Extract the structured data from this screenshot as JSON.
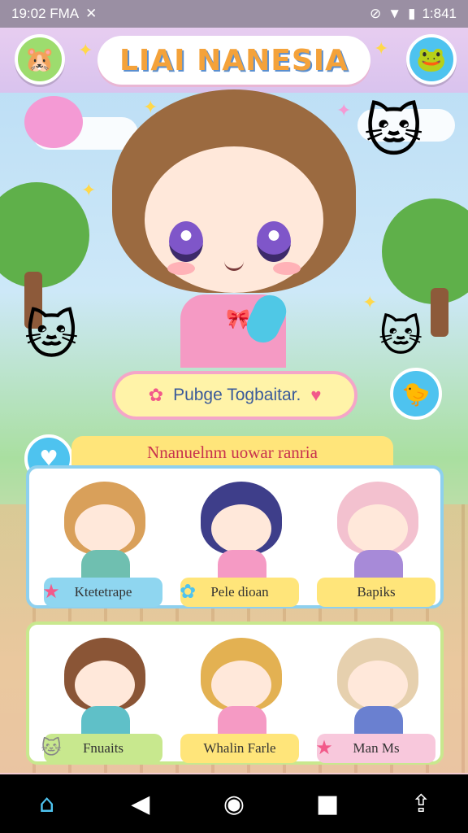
{
  "status_bar": {
    "time": "19:02 FMA",
    "clock": "1:841",
    "left_icon": "debug-icon",
    "right_icons": [
      "no-sim-icon",
      "wifi-icon",
      "battery-icon"
    ]
  },
  "header": {
    "title": "LIAI NANESIA",
    "avatar_icon": "hamster-icon",
    "menu_icon": "pet-face-icon"
  },
  "promo": {
    "label": "Pubge Togbaitar.",
    "icon": "star-icon",
    "heart_icon": "heart-icon"
  },
  "side_fab": {
    "icon": "bird-icon"
  },
  "section": {
    "title": "Nnanuelnm uowar ranria",
    "icon": "heart-icon"
  },
  "characters_row1": [
    {
      "label": "Ktetetrape",
      "hair": "#d9a05a",
      "body": "#6fbfb0",
      "label_bg": "#8fd6f0",
      "icon_color": "#f25a8a"
    },
    {
      "label": "Pele dioan",
      "hair": "#3e3e8a",
      "body": "#f59ac4",
      "label_bg": "#ffe57a",
      "icon_color": "#4ec3ef"
    },
    {
      "label": "Bapiks",
      "hair": "#f3c1cf",
      "body": "#a78ad8",
      "label_bg": "#ffe57a",
      "icon_color": "#ffd84a"
    }
  ],
  "characters_row2": [
    {
      "label": "Fnuaits",
      "hair": "#8a5536",
      "body": "#5fc0c8",
      "label_bg": "#c8e88e",
      "icon_color": "#888"
    },
    {
      "label": "Whalin Farle",
      "hair": "#e3b152",
      "body": "#f59ac4",
      "label_bg": "#ffe57a",
      "icon_color": "#ffd84a"
    },
    {
      "label": "Man Ms",
      "hair": "#e6d0ae",
      "body": "#6a80d0",
      "label_bg": "#f8c8dc",
      "icon_color": "#f25a8a"
    }
  ],
  "nav": {
    "home_icon": "home-icon",
    "back_icon": "back-icon",
    "circle_icon": "home-circle-icon",
    "recents_icon": "recents-icon",
    "share_icon": "share-icon"
  },
  "colors": {
    "accent": "#4ec3ef",
    "pink": "#f59ac4",
    "yellow": "#ffe57a"
  }
}
